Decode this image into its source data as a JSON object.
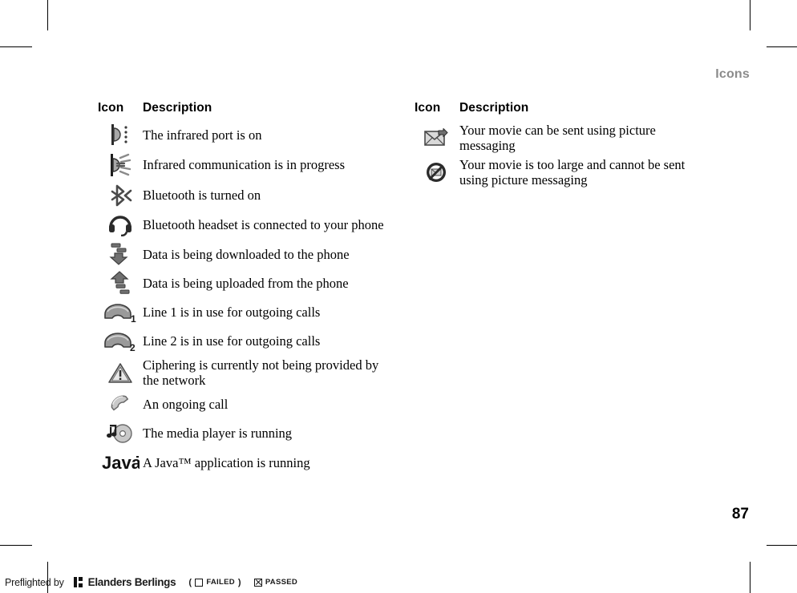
{
  "page": {
    "running_head": "Icons",
    "page_number": "87"
  },
  "columns": [
    {
      "id": "left",
      "header": {
        "icon": "Icon",
        "description": "Description"
      },
      "rows": [
        {
          "icon_name": "infrared-port-on-icon",
          "description": "The infrared port is on"
        },
        {
          "icon_name": "infrared-communication-icon",
          "description": "Infrared communication is in progress"
        },
        {
          "icon_name": "bluetooth-on-icon",
          "description": "Bluetooth is turned on"
        },
        {
          "icon_name": "bluetooth-headset-icon",
          "description": "Bluetooth headset is connected to your phone"
        },
        {
          "icon_name": "data-download-icon",
          "description": "Data is being downloaded to the phone"
        },
        {
          "icon_name": "data-upload-icon",
          "description": "Data is being uploaded from the phone"
        },
        {
          "icon_name": "line-1-outgoing-icon",
          "description": "Line 1 is in use for outgoing calls",
          "icon_badge": "1"
        },
        {
          "icon_name": "line-2-outgoing-icon",
          "description": "Line 2 is in use for outgoing calls",
          "icon_badge": "2"
        },
        {
          "icon_name": "ciphering-warning-icon",
          "description": "Ciphering is currently not being provided by the network"
        },
        {
          "icon_name": "ongoing-call-icon",
          "description": "An ongoing call"
        },
        {
          "icon_name": "media-player-running-icon",
          "description": "The media player is running"
        },
        {
          "icon_name": "java-application-icon",
          "description": "A Java™ application is running",
          "icon_label": "Java"
        }
      ]
    },
    {
      "id": "right",
      "header": {
        "icon": "Icon",
        "description": "Description"
      },
      "rows": [
        {
          "icon_name": "movie-sendable-icon",
          "description": "Your movie can be sent using picture messaging"
        },
        {
          "icon_name": "movie-too-large-icon",
          "description": "Your movie is too large and cannot be sent using picture messaging"
        }
      ]
    }
  ],
  "footer": {
    "preflight_label": "Preflighted by",
    "brand": "Elanders Berlings",
    "paren_open": "(",
    "failed_label": "FAILED",
    "paren_close": ")",
    "passed_label": "PASSED"
  },
  "colors": {
    "running_head": "#8b8b8b",
    "text": "#000000",
    "icon_dark": "#333333",
    "icon_mid": "#8c8c8c",
    "icon_light": "#c9c9c9"
  }
}
